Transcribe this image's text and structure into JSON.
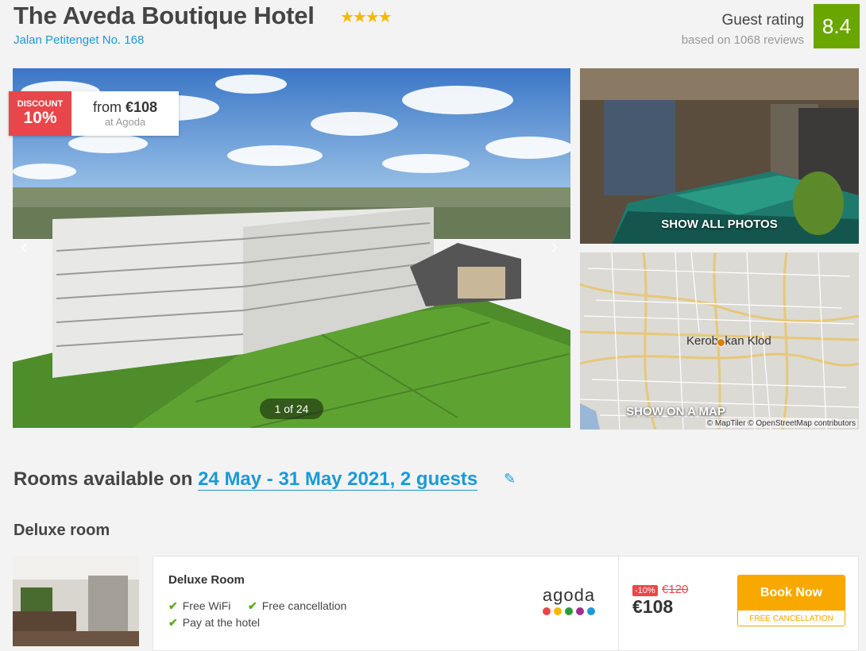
{
  "hotel": {
    "name": "The Aveda Boutique Hotel",
    "stars": "★★★★",
    "address": "Jalan Petitenget No. 168"
  },
  "rating": {
    "label": "Guest rating",
    "sub": "based on 1068 reviews",
    "score": "8.4",
    "color": "#6aa600"
  },
  "gallery": {
    "discount_label": "DISCOUNT",
    "discount_pct": "10%",
    "from_text": "from",
    "from_price": "€108",
    "at_text": "at Agoda",
    "counter": "1 of 24",
    "show_all": "SHOW ALL PHOTOS",
    "prev_icon": "‹",
    "next_icon": "›"
  },
  "map": {
    "city": "Kerobokan Klod",
    "label": "SHOW ON A MAP",
    "credit": "© MapTiler © OpenStreetMap contributors"
  },
  "rooms": {
    "heading": "Rooms available on",
    "dates": "24 May - 31 May 2021, 2 guests",
    "pencil_icon": "✎",
    "type": "Deluxe room"
  },
  "offer": {
    "name": "Deluxe Room",
    "features": [
      "Free WiFi",
      "Free cancellation",
      "Pay at the hotel"
    ],
    "check_icon": "✔",
    "provider": "agoda",
    "provider_dot_colors": [
      "#e8464a",
      "#f5b800",
      "#2c9a3d",
      "#a0308f",
      "#1a9ad6"
    ],
    "discount_badge": "-10%",
    "old_price": "€120",
    "price": "€108",
    "book_label": "Book Now",
    "book_sub": "FREE CANCELLATION"
  }
}
